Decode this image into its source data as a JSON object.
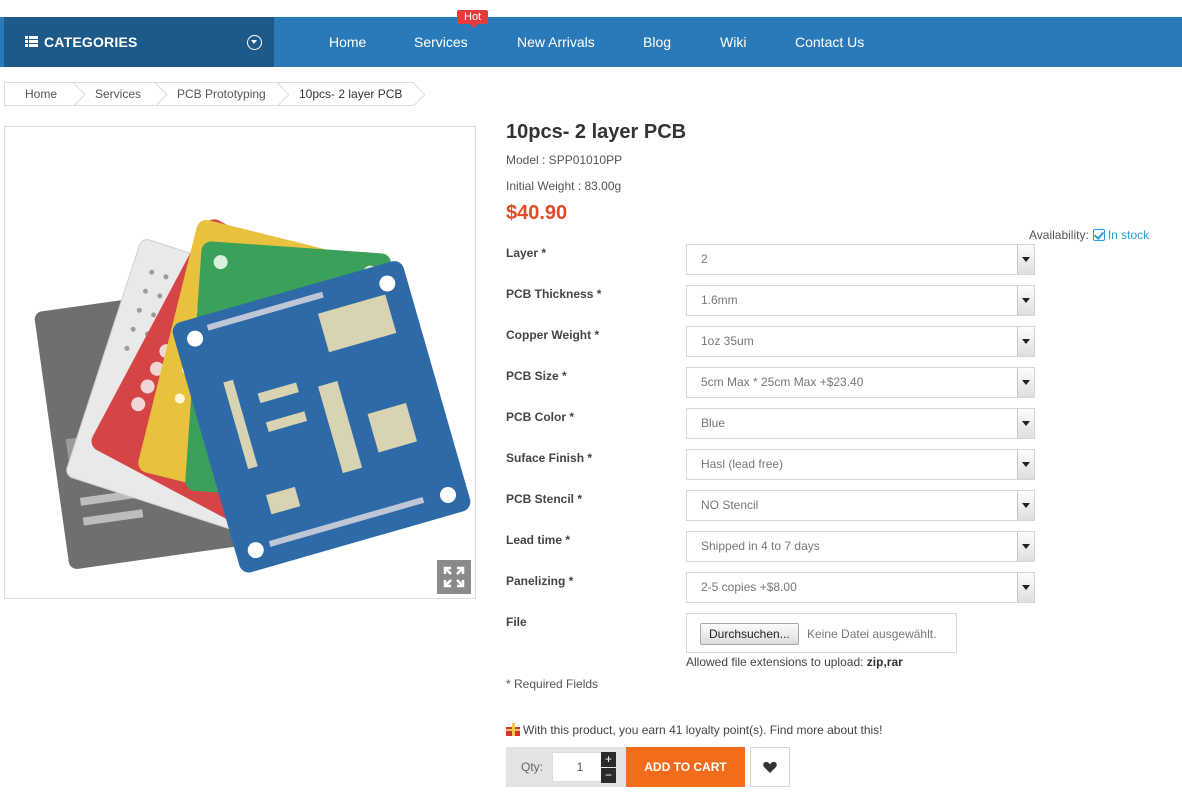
{
  "nav": {
    "categories_label": "CATEGORIES",
    "items": [
      {
        "label": "Home"
      },
      {
        "label": "Services",
        "badge": "Hot"
      },
      {
        "label": "New Arrivals"
      },
      {
        "label": "Blog"
      },
      {
        "label": "Wiki"
      },
      {
        "label": "Contact Us"
      }
    ]
  },
  "breadcrumb": [
    "Home",
    "Services",
    "PCB Prototyping",
    "10pcs- 2 layer PCB"
  ],
  "product": {
    "title": "10pcs- 2 layer PCB",
    "model": "Model : SPP01010PP",
    "weight": "Initial Weight : 83.00g",
    "price": "$40.90",
    "availability_label": "Availability:",
    "availability_value": "In stock"
  },
  "options": [
    {
      "label": "Layer *",
      "value": "2"
    },
    {
      "label": "PCB Thickness *",
      "value": "1.6mm"
    },
    {
      "label": "Copper Weight *",
      "value": "1oz 35um"
    },
    {
      "label": "PCB Size *",
      "value": "5cm Max * 25cm Max +$23.40"
    },
    {
      "label": "PCB Color *",
      "value": "Blue"
    },
    {
      "label": "Suface Finish *",
      "value": "Hasl (lead free)"
    },
    {
      "label": "PCB Stencil *",
      "value": "NO Stencil"
    },
    {
      "label": "Lead time *",
      "value": "Shipped in 4 to 7 days"
    },
    {
      "label": "Panelizing *",
      "value": "2-5 copies +$8.00"
    }
  ],
  "file": {
    "label": "File",
    "button": "Durchsuchen...",
    "status": "Keine Datei ausgewählt.",
    "allowed_prefix": "Allowed file extensions to upload:",
    "allowed_ext": "zip,rar"
  },
  "required_note": "* Required Fields",
  "loyalty_text": "With this product, you earn 41 loyalty point(s). Find more about this!",
  "cart": {
    "qty_label": "Qty:",
    "qty_value": "1",
    "plus": "+",
    "minus": "−",
    "add_to_cart": "ADD TO CART"
  },
  "icons": {
    "menu": "list-icon",
    "categories_toggle": "chevron-down-circle-icon",
    "availability": "check-square-icon",
    "expand": "expand-icon",
    "gift": "gift-icon",
    "wishlist": "heart-icon"
  },
  "colors": {
    "nav_bar": "#2a7ab9",
    "categories_bg": "#1d5a8a",
    "hot_badge": "#e23c3c",
    "price": "#e24b26",
    "in_stock": "#2a9bd7",
    "add_to_cart": "#f26c1b"
  }
}
